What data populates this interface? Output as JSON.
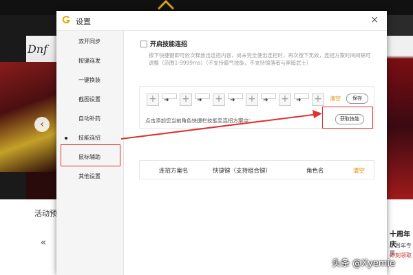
{
  "background": {
    "activity_label": "活动预",
    "dnf_logo_text": "Dnf",
    "right_title": "十周年庆",
    "right_subtitle": "十周年专属",
    "right_note": "即刻领取"
  },
  "watermark": "头条 @Xyemie",
  "dialog": {
    "title": "设置",
    "close_label": "×",
    "sidebar": {
      "items": [
        {
          "label": "双开同步"
        },
        {
          "label": "按键连发"
        },
        {
          "label": "一键换装"
        },
        {
          "label": "截图设置"
        },
        {
          "label": "自动补药"
        },
        {
          "label": "技能连招",
          "active": true
        },
        {
          "label": "鼠标辅助"
        },
        {
          "label": "其他设置"
        }
      ]
    },
    "combo": {
      "enable_label": "开启技能连招",
      "description": "按下快捷键即可依次释放出连招内容，尚未完全使出连招时，再次按下无效，连招方案时间间隔可调整（范围1-9999ms）（不支持霸气技能，不支持锦落者与黑暗武士）",
      "clear_label": "清空",
      "save_label": "保存",
      "hint": "点击添加您当前角色快捷栏技能至连招方案中：",
      "get_skill_label": "获取技能"
    },
    "table": {
      "columns": [
        "连招方案名",
        "快捷键（支持组合键）",
        "角色名"
      ],
      "clear_label": "清空"
    }
  },
  "colors": {
    "accent": "#e08a00",
    "highlight": "#e03030"
  }
}
